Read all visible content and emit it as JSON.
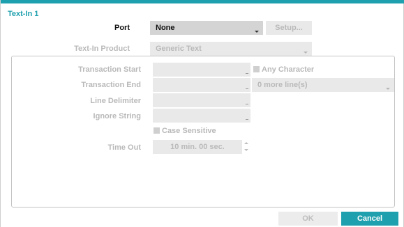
{
  "dialog": {
    "title": "Text-In 1",
    "accent_color": "#1fa0ae"
  },
  "port": {
    "label": "Port",
    "value": "None",
    "setup_label": "Setup..."
  },
  "product": {
    "label": "Text-In Product",
    "value": "Generic Text"
  },
  "settings": {
    "transaction_start": {
      "label": "Transaction Start",
      "value": ""
    },
    "any_character": {
      "label": "Any Character",
      "checked": false
    },
    "transaction_end": {
      "label": "Transaction End",
      "value": ""
    },
    "more_lines": {
      "value": "0 more line(s)"
    },
    "line_delimiter": {
      "label": "Line Delimiter",
      "value": ""
    },
    "ignore_string": {
      "label": "Ignore String",
      "value": ""
    },
    "case_sensitive": {
      "label": "Case Sensitive",
      "checked": false
    },
    "time_out": {
      "label": "Time Out",
      "value": "10 min. 00 sec."
    }
  },
  "footer": {
    "ok_label": "OK",
    "cancel_label": "Cancel"
  },
  "icons": [
    "dropdown-arrow-icon",
    "checkbox-icon",
    "spinner-up-icon",
    "spinner-down-icon"
  ]
}
